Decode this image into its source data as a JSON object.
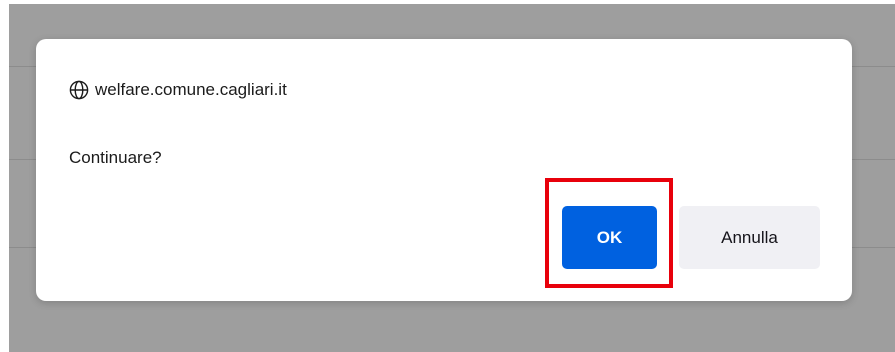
{
  "dialog": {
    "origin": "welfare.comune.cagliari.it",
    "message": "Continuare?",
    "ok_label": "OK",
    "cancel_label": "Annulla"
  },
  "colors": {
    "backdrop": "#9e9e9e",
    "ok_button": "#0061e0",
    "cancel_button": "#f0f0f4",
    "highlight": "#e8000b"
  },
  "icons": {
    "origin_icon": "globe-icon"
  }
}
